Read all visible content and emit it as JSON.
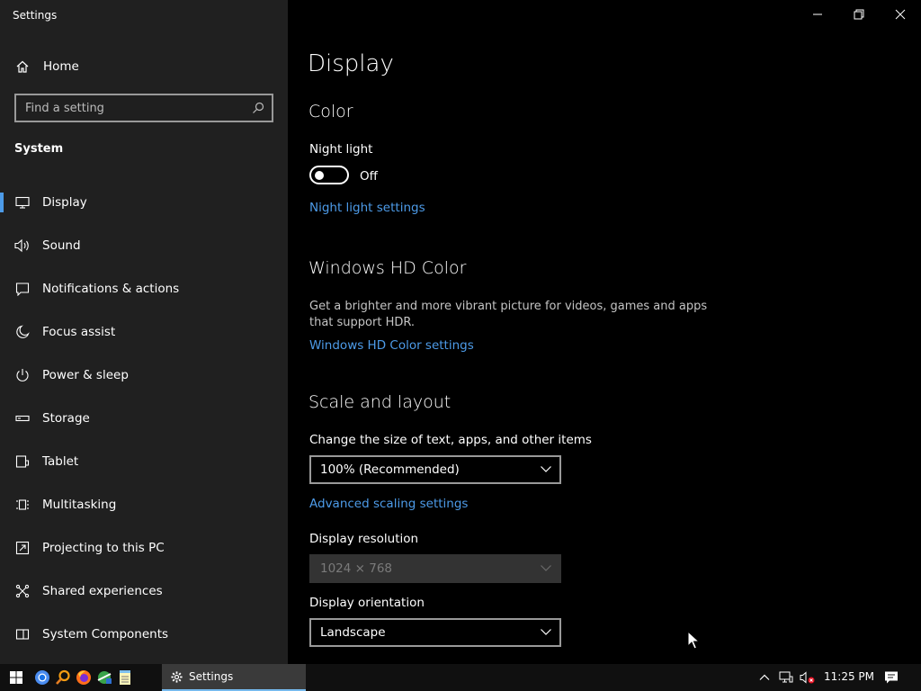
{
  "window": {
    "title": "Settings"
  },
  "sidebar": {
    "home_label": "Home",
    "search_placeholder": "Find a setting",
    "section": "System",
    "items": [
      {
        "label": "Display",
        "icon": "monitor-icon",
        "active": true
      },
      {
        "label": "Sound",
        "icon": "speaker-icon"
      },
      {
        "label": "Notifications & actions",
        "icon": "notification-icon"
      },
      {
        "label": "Focus assist",
        "icon": "moon-icon"
      },
      {
        "label": "Power & sleep",
        "icon": "power-icon"
      },
      {
        "label": "Storage",
        "icon": "storage-icon"
      },
      {
        "label": "Tablet",
        "icon": "tablet-icon"
      },
      {
        "label": "Multitasking",
        "icon": "multitasking-icon"
      },
      {
        "label": "Projecting to this PC",
        "icon": "projecting-icon"
      },
      {
        "label": "Shared experiences",
        "icon": "shared-icon"
      },
      {
        "label": "System Components",
        "icon": "components-icon"
      }
    ]
  },
  "main": {
    "title": "Display",
    "color": {
      "heading": "Color",
      "night_light_label": "Night light",
      "night_light_state": "Off",
      "night_light_link": "Night light settings"
    },
    "hdr": {
      "heading": "Windows HD Color",
      "description": "Get a brighter and more vibrant picture for videos, games and apps that support HDR.",
      "link": "Windows HD Color settings"
    },
    "scale": {
      "heading": "Scale and layout",
      "size_label": "Change the size of text, apps, and other items",
      "size_value": "100% (Recommended)",
      "advanced_link": "Advanced scaling settings",
      "resolution_label": "Display resolution",
      "resolution_value": "1024 × 768",
      "orientation_label": "Display orientation",
      "orientation_value": "Landscape"
    }
  },
  "taskbar": {
    "active_app": "Settings",
    "clock": "11:25 PM"
  },
  "colors": {
    "accent": "#4d9be8",
    "sidebar_bg": "#202020",
    "main_bg": "#000000"
  }
}
